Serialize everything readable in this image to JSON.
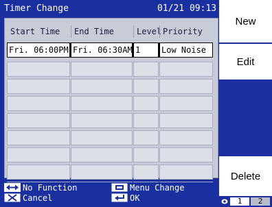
{
  "title": "Timer Change",
  "datetime": "01/21 09:13",
  "columns": [
    "Start Time",
    "End Time",
    "Level",
    "Priority"
  ],
  "rows": [
    {
      "start": "Fri. 06:00PM",
      "end": "Fri. 06:30AM",
      "level": "1",
      "priority": "Low Noise"
    }
  ],
  "empty_row_count": 8,
  "buttons": {
    "new": "New",
    "edit": "Edit",
    "delete": "Delete"
  },
  "status": {
    "no_function": "No Function",
    "menu_change": "Menu Change",
    "cancel": "Cancel",
    "ok": "OK"
  },
  "pager": {
    "page1": "1",
    "page2": "2"
  },
  "colors": {
    "background": "#1a2fa0",
    "panel": "#c8ccd8",
    "selected_row": "#ffffff"
  }
}
